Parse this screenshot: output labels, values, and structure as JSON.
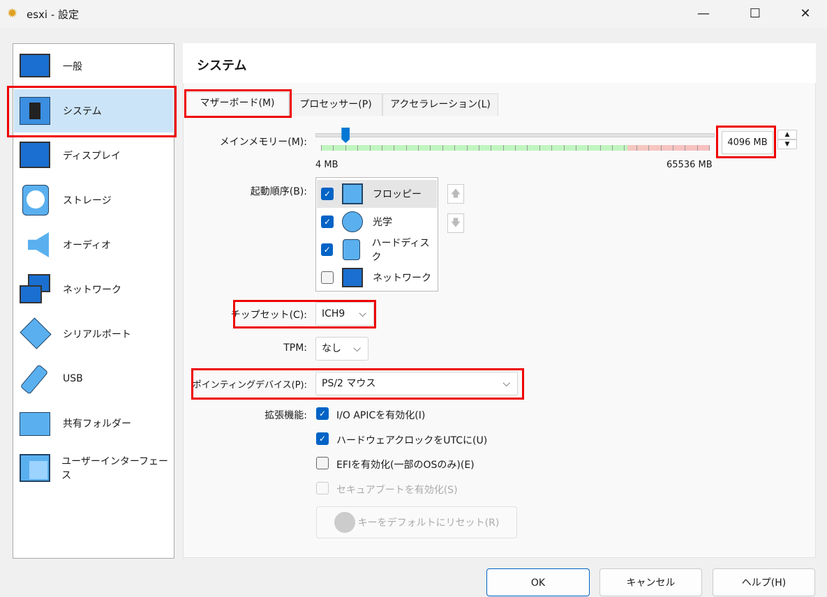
{
  "window": {
    "title": "esxi - 設定",
    "minimize": "—",
    "maximize": "☐",
    "close": "✕"
  },
  "sidebar": {
    "items": [
      {
        "label": "一般",
        "icon": "monitor-icon"
      },
      {
        "label": "システム",
        "icon": "chip-icon"
      },
      {
        "label": "ディスプレイ",
        "icon": "display-icon"
      },
      {
        "label": "ストレージ",
        "icon": "storage-icon"
      },
      {
        "label": "オーディオ",
        "icon": "speaker-icon"
      },
      {
        "label": "ネットワーク",
        "icon": "network-icon"
      },
      {
        "label": "シリアルポート",
        "icon": "serial-port-icon"
      },
      {
        "label": "USB",
        "icon": "usb-icon"
      },
      {
        "label": "共有フォルダー",
        "icon": "folder-icon"
      },
      {
        "label": "ユーザーインターフェース",
        "icon": "ui-icon"
      }
    ],
    "selected": "システム"
  },
  "panel": {
    "title": "システム",
    "tabs": [
      {
        "label": "マザーボード(M)"
      },
      {
        "label": "プロセッサー(P)"
      },
      {
        "label": "アクセラレーション(L)"
      }
    ],
    "memory": {
      "label": "メインメモリー(M):",
      "value_mb": 4096,
      "value_text": "4096 MB",
      "min_text": "4 MB",
      "max_text": "65536 MB"
    },
    "boot": {
      "label": "起動順序(B):",
      "items": [
        {
          "label": "フロッピー",
          "checked": true,
          "icon": "floppy-icon"
        },
        {
          "label": "光学",
          "checked": true,
          "icon": "optical-disc-icon"
        },
        {
          "label": "ハードディスク",
          "checked": true,
          "icon": "hard-disk-icon"
        },
        {
          "label": "ネットワーク",
          "checked": false,
          "icon": "network-icon"
        }
      ],
      "up": "🡅",
      "down": "🡇"
    },
    "chipset": {
      "label": "チップセット(C):",
      "value": "ICH9"
    },
    "tpm": {
      "label": "TPM:",
      "value": "なし"
    },
    "pointing": {
      "label": "ポインティングデバイス(P):",
      "value": "PS/2 マウス"
    },
    "ext": {
      "label": "拡張機能:",
      "options": [
        {
          "label": "I/O APICを有効化(I)",
          "checked": true
        },
        {
          "label": "ハードウェアクロックをUTCに(U)",
          "checked": true
        },
        {
          "label": "EFIを有効化(一部のOSのみ)(E)",
          "checked": false
        },
        {
          "label": "セキュアブートを有効化(S)",
          "checked": false,
          "disabled": true
        }
      ]
    },
    "reset_keys": "キーをデフォルトにリセット(R)"
  },
  "buttons": {
    "ok": "OK",
    "cancel": "キャンセル",
    "help": "ヘルプ(H)"
  },
  "colors": {
    "accent": "#0063c6",
    "selected_bg": "#cce4f7",
    "highlight": "#ee0000"
  }
}
